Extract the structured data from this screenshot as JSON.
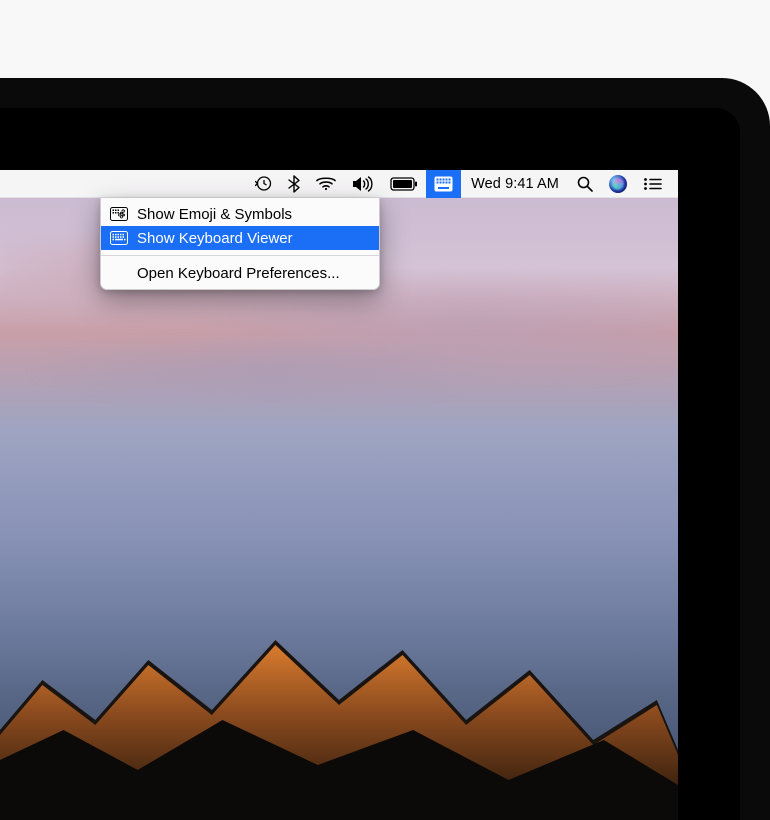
{
  "menubar": {
    "clock_text": "Wed 9:41 AM",
    "icons": {
      "time_machine": "time-machine-icon",
      "bluetooth": "bluetooth-icon",
      "wifi": "wifi-icon",
      "volume": "volume-icon",
      "battery": "battery-icon",
      "input_menu": "input-menu-icon",
      "spotlight": "spotlight-icon",
      "siri": "siri-icon",
      "notification_center": "notification-center-icon"
    }
  },
  "dropdown": {
    "items": [
      {
        "label": "Show Emoji & Symbols",
        "icon": "character-viewer-icon",
        "highlighted": false
      },
      {
        "label": "Show Keyboard Viewer",
        "icon": "keyboard-viewer-icon",
        "highlighted": true
      }
    ],
    "footer_item": {
      "label": "Open Keyboard Preferences..."
    }
  },
  "colors": {
    "highlight": "#1a6ff6",
    "menubar_bg": "#f8f8f8"
  }
}
